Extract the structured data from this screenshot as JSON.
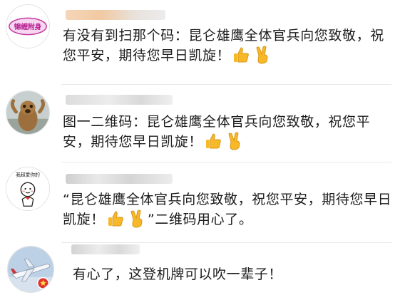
{
  "comments": [
    {
      "avatar_icon": "cartoon-badge-avatar",
      "avatar_text": "锦鲤附身",
      "username_redacted": true,
      "text_before": "有没有到扫那个码：昆仑雄鹰全体官兵向您致敬，祝您平安，期待您早日凯旋！",
      "emojis": [
        "thumbs-up-icon",
        "victory-hand-icon"
      ],
      "text_after": ""
    },
    {
      "avatar_icon": "meerkat-photo-avatar",
      "username_redacted": true,
      "text_before": "图一二维码：昆仑雄鹰全体官兵向您致敬，祝您平安，期待您早日凯旋！",
      "emojis": [
        "thumbs-up-icon",
        "victory-hand-icon"
      ],
      "text_after": ""
    },
    {
      "avatar_icon": "stick-figure-avatar",
      "avatar_text": "我超爱你的",
      "username_redacted": true,
      "text_before": "“昆仑雄鹰全体官兵向您致敬，祝您平安，期待您早日凯旋！",
      "emojis": [
        "thumbs-up-icon",
        "victory-hand-icon"
      ],
      "text_after": "”二维码用心了。"
    },
    {
      "avatar_icon": "airplane-photo-avatar",
      "username_redacted": true,
      "text_before": "有心了，这登机牌可以吹一辈子！",
      "emojis": [],
      "text_after": ""
    }
  ],
  "colors": {
    "text": "#1c1c1c",
    "divider": "#e8e8e8",
    "badge_red": "#e0342c",
    "emoji_yellow": "#f7b928"
  }
}
